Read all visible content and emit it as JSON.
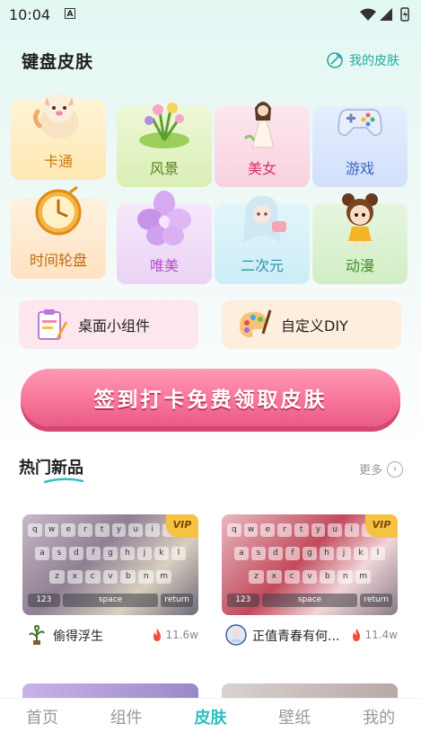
{
  "status": {
    "time": "10:04",
    "badge": "A"
  },
  "header": {
    "title": "键盘皮肤",
    "my_skins": "我的皮肤"
  },
  "categories": [
    {
      "label": "卡通",
      "icon": "cat-icon",
      "color": "#c8780a"
    },
    {
      "label": "风景",
      "icon": "flower-bush-icon",
      "color": "#5a7a1e"
    },
    {
      "label": "美女",
      "icon": "girl-icon",
      "color": "#d6336c"
    },
    {
      "label": "游戏",
      "icon": "gamepad-icon",
      "color": "#3a66c4"
    },
    {
      "label": "时间轮盘",
      "icon": "clock-icon",
      "color": "#c06a10"
    },
    {
      "label": "唯美",
      "icon": "petal-flower-icon",
      "color": "#b64fc8"
    },
    {
      "label": "二次元",
      "icon": "anime-girl-icon",
      "color": "#2b93a5"
    },
    {
      "label": "动漫",
      "icon": "cartoon-girl-icon",
      "color": "#3e8f2c"
    }
  ],
  "widgets": {
    "desktop": "桌面小组件",
    "diy": "自定义DIY"
  },
  "checkin_label": "签到打卡免费领取皮肤",
  "section": {
    "title": "热门新品",
    "more": "更多"
  },
  "keyboard_keys": {
    "row1": [
      "q",
      "w",
      "e",
      "r",
      "t",
      "y",
      "u",
      "i",
      "o",
      "p"
    ],
    "row2": [
      "a",
      "s",
      "d",
      "f",
      "g",
      "h",
      "j",
      "k",
      "l"
    ],
    "row3": [
      "z",
      "x",
      "c",
      "v",
      "b",
      "n",
      "m"
    ],
    "row4": [
      "123",
      "space",
      "return"
    ]
  },
  "skins": [
    {
      "name": "偷得浮生",
      "heat": "11.6w",
      "badge": "VIP"
    },
    {
      "name": "正值青春有何...",
      "heat": "11.4w",
      "badge": "VIP"
    }
  ],
  "nav": [
    "首页",
    "组件",
    "皮肤",
    "壁纸",
    "我的"
  ],
  "nav_active": "皮肤",
  "colors": {
    "accent": "#2cc0c4",
    "checkin": "#f8759a"
  }
}
